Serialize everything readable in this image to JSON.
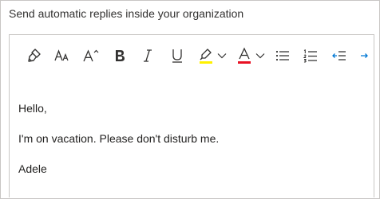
{
  "heading": "Send automatic replies inside your organization",
  "toolbar": {
    "buttons": [
      {
        "name": "format-painter",
        "icon": "format-painter-icon"
      },
      {
        "name": "font-size",
        "icon": "font-size-icon",
        "label": "AA"
      },
      {
        "name": "grow-font",
        "icon": "grow-font-icon",
        "label": "A"
      },
      {
        "name": "bold",
        "icon": "bold-icon",
        "label": "B"
      },
      {
        "name": "italic",
        "icon": "italic-icon",
        "label": "I"
      },
      {
        "name": "underline",
        "icon": "underline-icon",
        "label": "U"
      },
      {
        "name": "highlight",
        "icon": "highlighter-icon",
        "color": "#fff100"
      },
      {
        "name": "font-color",
        "icon": "font-color-icon",
        "label": "A",
        "color": "#e81123"
      },
      {
        "name": "bullets",
        "icon": "bulleted-list-icon"
      },
      {
        "name": "numbering",
        "icon": "numbered-list-icon"
      },
      {
        "name": "decrease-indent",
        "icon": "decrease-indent-icon"
      },
      {
        "name": "more",
        "icon": "arrow-right-icon"
      }
    ]
  },
  "message": {
    "greeting": "Hello,",
    "body": "I'm on vacation. Please don't disturb me.",
    "signature": "Adele"
  },
  "colors": {
    "accent": "#0078d4",
    "border": "#c8c6c4",
    "text": "#323130"
  }
}
